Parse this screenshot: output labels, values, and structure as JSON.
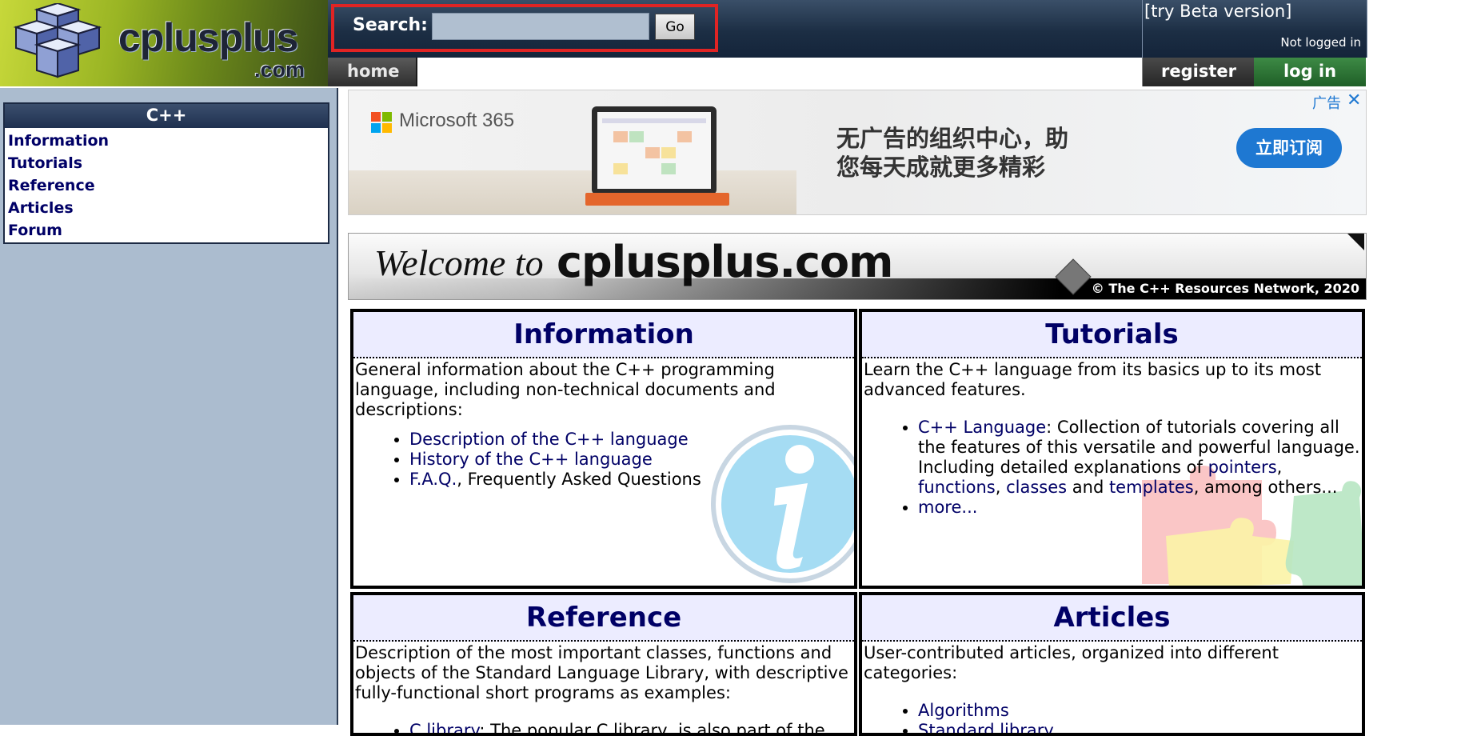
{
  "header": {
    "logo": {
      "wordmark": "cplusplus",
      "dotcom": ".com"
    },
    "search": {
      "label": "Search:",
      "value": "",
      "button": "Go"
    },
    "beta_link": "[try Beta version]",
    "login_status": "Not logged in",
    "nav": {
      "home": "home",
      "register": "register",
      "login": "log in"
    }
  },
  "sidebar": {
    "title": "C++",
    "items": [
      {
        "label": "Information"
      },
      {
        "label": "Tutorials"
      },
      {
        "label": "Reference"
      },
      {
        "label": "Articles"
      },
      {
        "label": "Forum"
      }
    ]
  },
  "ad": {
    "brand": "Microsoft 365",
    "headline_line1": "无广告的组织中心，助",
    "headline_line2": "您每天成就更多精彩",
    "cta": "立即订阅",
    "ad_flag": "广告",
    "close": "✕"
  },
  "welcome": {
    "prefix": "Welcome to",
    "site": "cplusplus.com",
    "copyright": "© The C++ Resources Network, 2020"
  },
  "sections": {
    "information": {
      "title": "Information",
      "intro": "General information about the C++ programming language, including non-technical documents and descriptions:",
      "links": [
        {
          "text": "Description of the C++ language",
          "suffix": ""
        },
        {
          "text": "History of the C++ language",
          "suffix": ""
        },
        {
          "text": "F.A.Q.",
          "suffix": ", Frequently Asked Questions"
        }
      ]
    },
    "tutorials": {
      "title": "Tutorials",
      "intro": "Learn the C++ language from its basics up to its most advanced features.",
      "item1_link": "C++ Language",
      "item1_text_a": ": Collection of tutorials covering all the features of this versatile and powerful language. Including detailed explanations of ",
      "item1_pointers": "pointers",
      "item1_sep1": ", ",
      "item1_functions": "functions",
      "item1_sep2": ", ",
      "item1_classes": "classes",
      "item1_and": " and ",
      "item1_templates": "templates",
      "item1_text_b": ", among others...",
      "item2_link": "more..."
    },
    "reference": {
      "title": "Reference",
      "intro": "Description of the most important classes, functions and objects of the Standard Language Library, with descriptive fully-functional short programs as examples:",
      "item1_link": "C library",
      "item1_text": ": The popular C library, is also part of the"
    },
    "articles": {
      "title": "Articles",
      "intro": "User-contributed articles, organized into different categories:",
      "item1_link": "Algorithms",
      "item2_link": "Standard library"
    }
  }
}
